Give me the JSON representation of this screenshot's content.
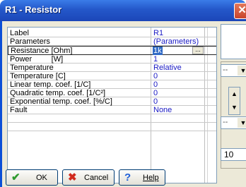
{
  "window": {
    "title": "R1 - Resistor",
    "close": "✕"
  },
  "properties": [
    {
      "label": "Label",
      "value": "R1"
    },
    {
      "label": "Parameters",
      "value": "(Parameters)"
    },
    {
      "label": "Resistance [Ohm]",
      "value": "1k"
    },
    {
      "label": "Power         [W]",
      "value": "1"
    },
    {
      "label": "Temperature",
      "value": "Relative"
    },
    {
      "label": "Temperature [C]",
      "value": "0"
    },
    {
      "label": "Linear temp. coef. [1/C]",
      "value": "0"
    },
    {
      "label": "Quadratic temp. coef. [1/C²]",
      "value": "0"
    },
    {
      "label": "Exponential temp. coef. [%/C]",
      "value": "0"
    },
    {
      "label": "Fault",
      "value": "None"
    }
  ],
  "editor": {
    "ellipsis": "..."
  },
  "side": {
    "combo1_text": "--",
    "combo2_text": "--",
    "spin_up": "▲",
    "spin_down": "▼",
    "number_value": "10"
  },
  "buttons": {
    "ok": {
      "label": "OK",
      "icon": "✔"
    },
    "cancel": {
      "label": "Cancel",
      "icon": "✖"
    },
    "help": {
      "label": "Help",
      "icon": "?"
    }
  },
  "colors": {
    "value_text": "#1a1ac4",
    "ok_icon": "#2e9a2e",
    "cancel_icon": "#d12b1f",
    "help_icon": "#1f5fd8"
  }
}
